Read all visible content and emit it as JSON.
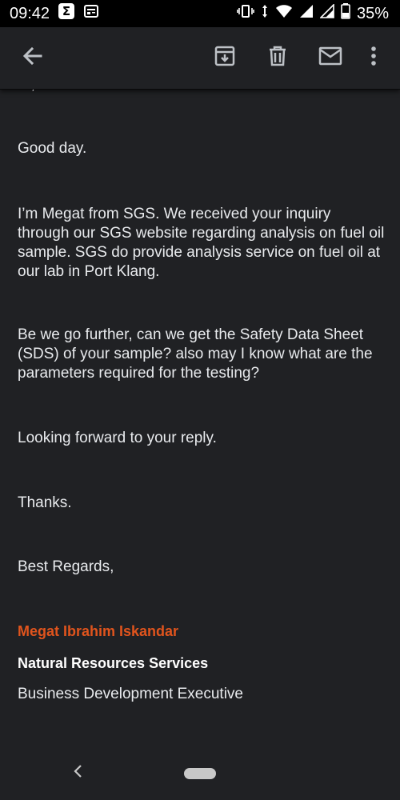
{
  "status_bar": {
    "time": "09:42",
    "battery": "35%",
    "notification_icons": [
      "sigma-app-icon",
      "news-app-icon"
    ],
    "system_icons": [
      "vibrate-icon",
      "data-arrows-icon",
      "wifi-icon",
      "signal-icon",
      "signal-icon-2",
      "battery-icon"
    ]
  },
  "app_bar": {
    "icons": [
      "back-arrow-icon",
      "archive-icon",
      "delete-icon",
      "mail-icon",
      "more-vert-icon"
    ]
  },
  "email": {
    "clipped_top_text": "...,",
    "greeting": "Good day.",
    "para1": "I’m Megat from SGS. We received your inquiry through our SGS website regarding analysis on fuel oil sample. SGS do provide analysis service on fuel oil at our lab in Port Klang.",
    "para2": "Be we go further, can we get the Safety Data Sheet (SDS) of your sample? also may I know what are the parameters required for the testing?",
    "para3": "Looking forward to your reply.",
    "thanks": "Thanks.",
    "closing": "Best Regards,",
    "signature": {
      "name": "Megat Ibrahim Iskandar",
      "department": "Natural Resources Services",
      "title": "Business Development Executive"
    }
  },
  "colors": {
    "background": "#202124",
    "text": "#e8eaed",
    "signature_name": "#e0541d"
  }
}
